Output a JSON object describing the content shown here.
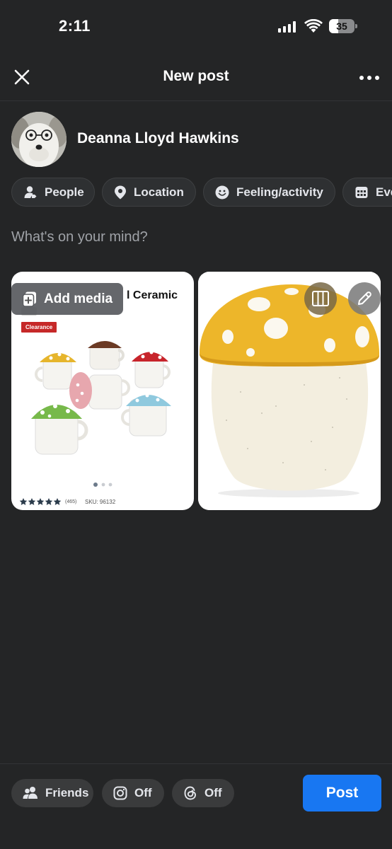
{
  "status_bar": {
    "time": "2:11",
    "battery": "35",
    "battery_level": 0.35
  },
  "header": {
    "title": "New post"
  },
  "author": {
    "name": "Deanna Lloyd Hawkins"
  },
  "chips": [
    {
      "label": "People",
      "icon": "person-tag-icon"
    },
    {
      "label": "Location",
      "icon": "location-pin-icon"
    },
    {
      "label": "Feeling/activity",
      "icon": "smiley-icon"
    },
    {
      "label": "Events",
      "icon": "calendar-icon"
    }
  ],
  "composer": {
    "placeholder": "What's on your mind?"
  },
  "media": {
    "add_media_label": "Add media",
    "left_card": {
      "title_partial": "l Ceramic",
      "badge": "Clearance",
      "rating_count": "(465)",
      "sku": "SKU: 96132"
    }
  },
  "bottom": {
    "audience_label": "Friends",
    "instagram_label": "Off",
    "threads_label": "Off",
    "post_label": "Post"
  },
  "colors": {
    "accent": "#1877f2",
    "background": "#242526",
    "badge": "#c62828"
  }
}
